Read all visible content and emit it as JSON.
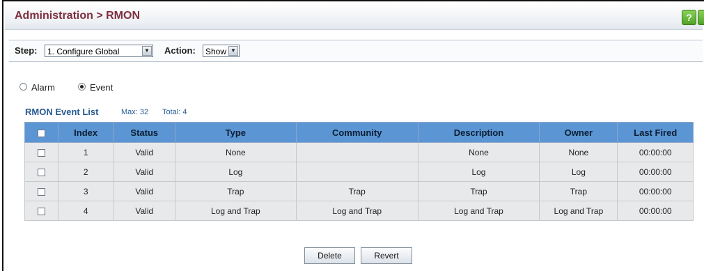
{
  "header": {
    "title": "Administration > RMON",
    "help_icon": "?"
  },
  "step": {
    "step_label": "Step:",
    "step_value": "1. Configure Global",
    "action_label": "Action:",
    "action_value": "Show"
  },
  "radios": [
    {
      "label": "Alarm",
      "selected": false
    },
    {
      "label": "Event",
      "selected": true
    }
  ],
  "list": {
    "title": "RMON Event List",
    "max": "Max: 32",
    "total": "Total: 4"
  },
  "table": {
    "columns": [
      "Index",
      "Status",
      "Type",
      "Community",
      "Description",
      "Owner",
      "Last Fired"
    ],
    "rows": [
      [
        "1",
        "Valid",
        "None",
        "",
        "None",
        "None",
        "00:00:00"
      ],
      [
        "2",
        "Valid",
        "Log",
        "",
        "Log",
        "Log",
        "00:00:00"
      ],
      [
        "3",
        "Valid",
        "Trap",
        "Trap",
        "Trap",
        "Trap",
        "00:00:00"
      ],
      [
        "4",
        "Valid",
        "Log and Trap",
        "Log and Trap",
        "Log and Trap",
        "Log and Trap",
        "00:00:00"
      ]
    ]
  },
  "buttons": {
    "delete": "Delete",
    "revert": "Revert"
  }
}
